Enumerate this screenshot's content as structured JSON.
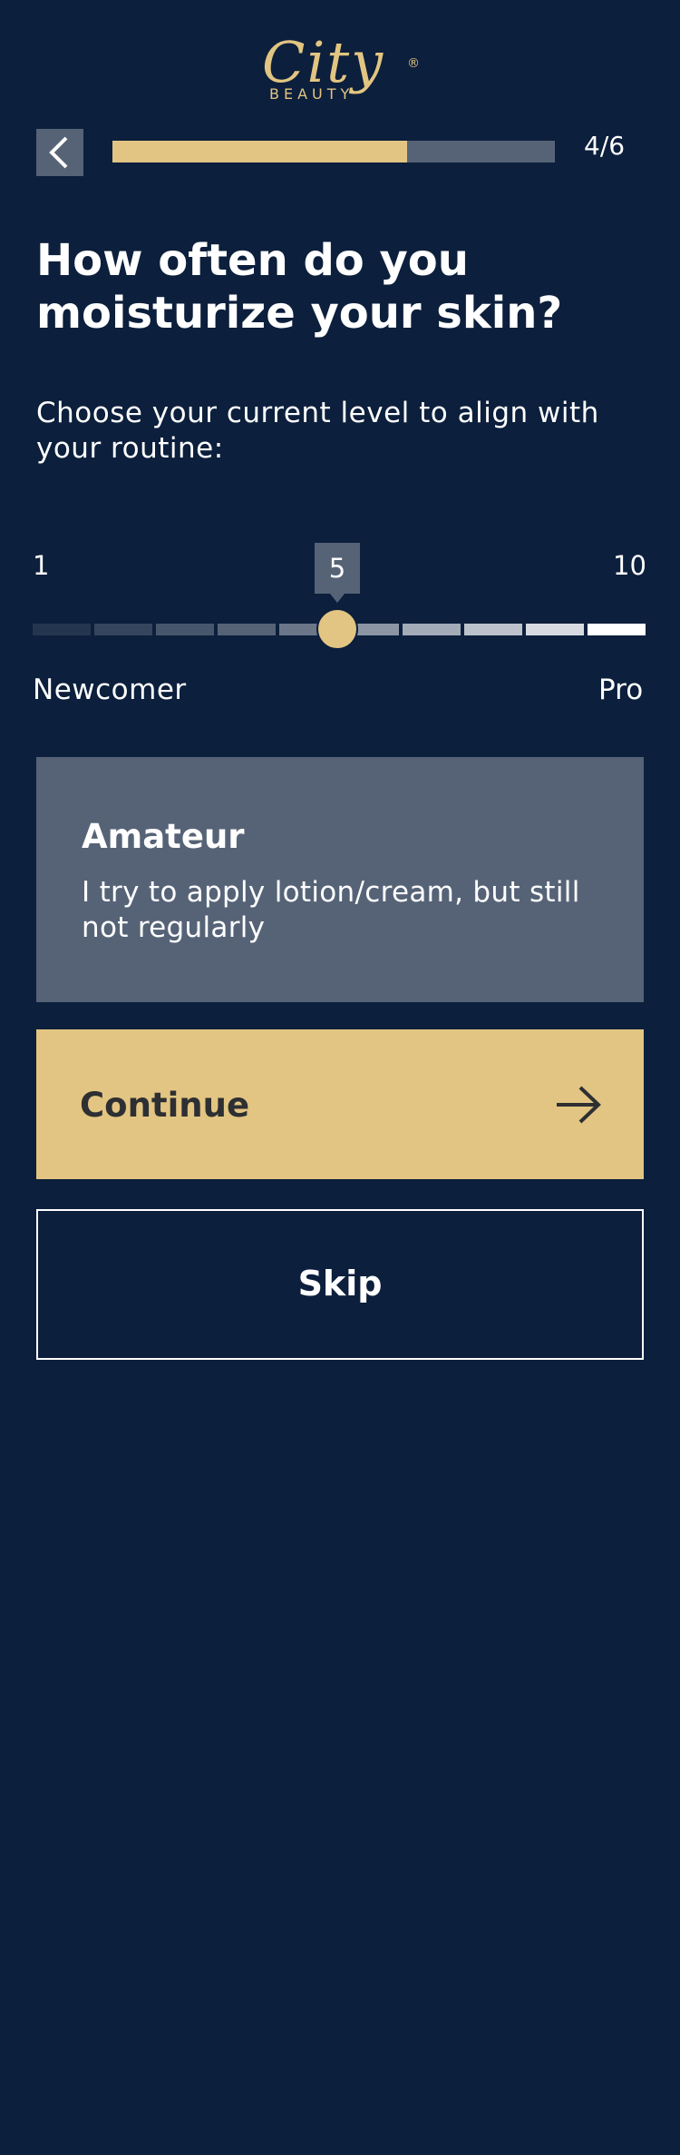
{
  "brand": {
    "logo_script": "City",
    "logo_sub": "BEAUTY",
    "logo_mark": "®"
  },
  "nav": {
    "back_icon": "chevron-left-icon",
    "step_label": "4/6",
    "progress": 0.667
  },
  "question": {
    "title": "How often do you moisturize your skin?",
    "subtitle": "Choose your current level to align with your routine:"
  },
  "scale": {
    "min_label": "1",
    "max_label": "10",
    "value": 5,
    "value_label": "5",
    "left_caption": "Newcomer",
    "right_caption": "Pro",
    "segment_count": 10,
    "segment_colors": [
      "#24364f",
      "#34455d",
      "#46566c",
      "#566377",
      "#6b7789",
      "#8b95a4",
      "#a3abb8",
      "#bcc2cc",
      "#d7dbe1",
      "#ffffff"
    ]
  },
  "level": {
    "name": "Amateur",
    "description": "I try to apply lotion/cream, but still not regularly"
  },
  "actions": {
    "continue_label": "Continue",
    "continue_icon": "arrow-right-icon",
    "skip_label": "Skip"
  },
  "colors": {
    "background": "#0c1f3c",
    "accent": "#e2c582",
    "muted": "#566377",
    "button_text": "#2e2f33"
  }
}
